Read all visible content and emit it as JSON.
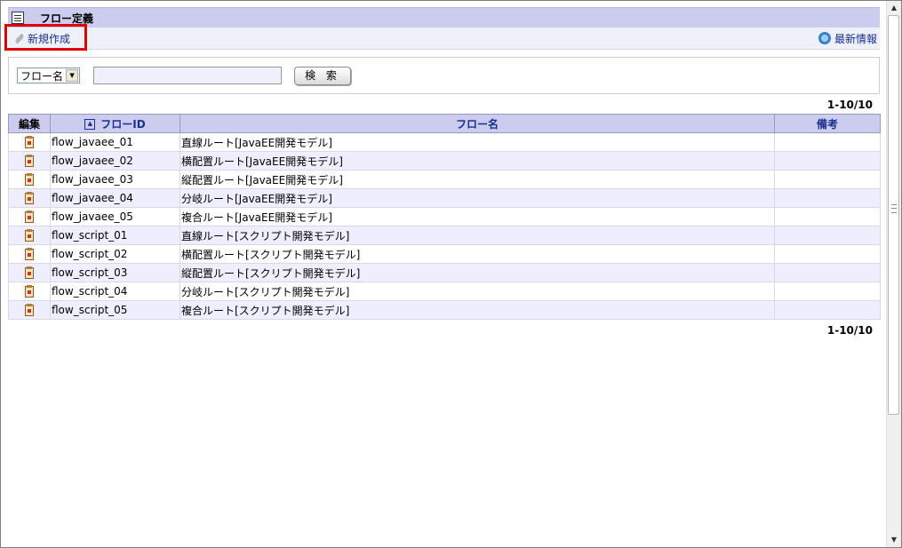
{
  "page": {
    "title": "フロー定義"
  },
  "toolbar": {
    "new_label": "新規作成",
    "refresh_label": "最新情報"
  },
  "search": {
    "field_select": "フロー名",
    "input_value": "",
    "button_label": "検 索"
  },
  "pager": {
    "top": "1-10/10",
    "bottom": "1-10/10"
  },
  "table": {
    "headers": {
      "edit": "編集",
      "flow_id": "フローID",
      "flow_name": "フロー名",
      "note": "備考"
    },
    "rows": [
      {
        "id": "flow_javaee_01",
        "name": "直線ルート[JavaEE開発モデル]",
        "note": ""
      },
      {
        "id": "flow_javaee_02",
        "name": "横配置ルート[JavaEE開発モデル]",
        "note": ""
      },
      {
        "id": "flow_javaee_03",
        "name": "縦配置ルート[JavaEE開発モデル]",
        "note": ""
      },
      {
        "id": "flow_javaee_04",
        "name": "分岐ルート[JavaEE開発モデル]",
        "note": ""
      },
      {
        "id": "flow_javaee_05",
        "name": "複合ルート[JavaEE開発モデル]",
        "note": ""
      },
      {
        "id": "flow_script_01",
        "name": "直線ルート[スクリプト開発モデル]",
        "note": ""
      },
      {
        "id": "flow_script_02",
        "name": "横配置ルート[スクリプト開発モデル]",
        "note": ""
      },
      {
        "id": "flow_script_03",
        "name": "縦配置ルート[スクリプト開発モデル]",
        "note": ""
      },
      {
        "id": "flow_script_04",
        "name": "分岐ルート[スクリプト開発モデル]",
        "note": ""
      },
      {
        "id": "flow_script_05",
        "name": "複合ルート[スクリプト開発モデル]",
        "note": ""
      }
    ]
  },
  "colors": {
    "header_bg": "#ccccee",
    "link": "#1a2f8c",
    "highlight": "#e00000",
    "alt_row": "#eeeeff"
  }
}
